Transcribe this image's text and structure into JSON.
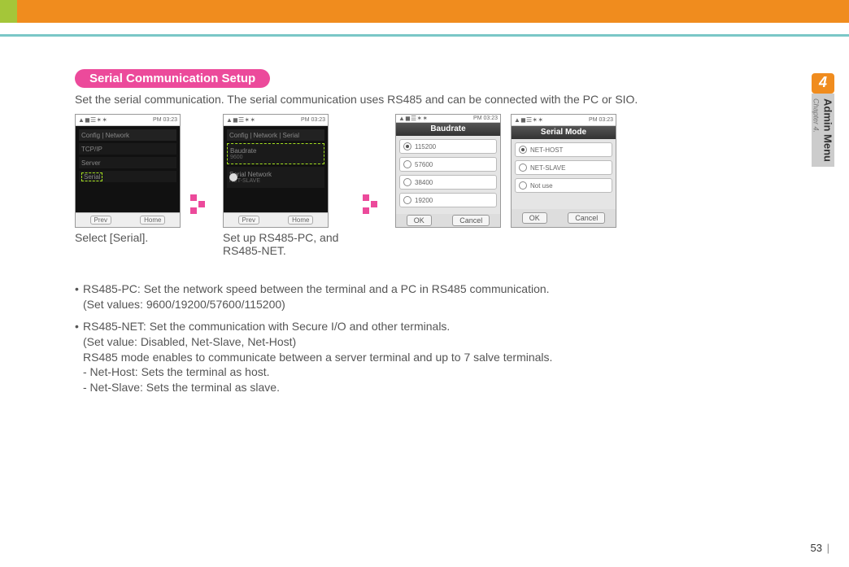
{
  "header": {
    "section_title": "Serial Communication Setup",
    "intro": "Set the serial communication. The serial communication uses RS485 and can be connected with the PC or SIO."
  },
  "screens": {
    "status_icons": "▲ ◼ ☰ ✶ ✶",
    "status_time": "PM 03:23",
    "screen1": {
      "title_row": "Config | Network",
      "row1": "TCP/IP",
      "row2": "Server",
      "row3_sel": "Serial",
      "footer_prev": "Prev",
      "footer_home": "Home",
      "caption": "Select [Serial]."
    },
    "screen2": {
      "title_row": "Config | Network | Serial",
      "row1_sel_a": "Baudrate",
      "row1_sel_b": "9600",
      "row2": "Serial Network",
      "row2_sub": "NET-SLAVE",
      "caption": "Set up RS485-PC, and RS485-NET."
    },
    "baudrate": {
      "title": "Baudrate",
      "opt1": "115200",
      "opt2": "57600",
      "opt3": "38400",
      "opt4": "19200",
      "ok": "OK",
      "cancel": "Cancel"
    },
    "serialmode": {
      "title": "Serial Mode",
      "opt1": "NET-HOST",
      "opt2": "NET-SLAVE",
      "opt3": "Not use",
      "ok": "OK",
      "cancel": "Cancel"
    }
  },
  "bullets": {
    "b1_line1": "RS485-PC: Set the network speed between the terminal and a PC in RS485 communication.",
    "b1_line2": "(Set values: 9600/19200/57600/115200)",
    "b2_line1": "RS485-NET: Set the communication with Secure I/O and other terminals.",
    "b2_line2": "(Set value: Disabled, Net-Slave, Net-Host)",
    "b2_line3": "RS485 mode enables to communicate between a server terminal and up to 7 salve terminals.",
    "b2_line4": "- Net-Host: Sets the terminal as host.",
    "b2_line5": "- Net-Slave: Sets the terminal as slave."
  },
  "side": {
    "number": "4",
    "chapter": "Chapter 4.",
    "title": "Admin Menu"
  },
  "page": "53"
}
